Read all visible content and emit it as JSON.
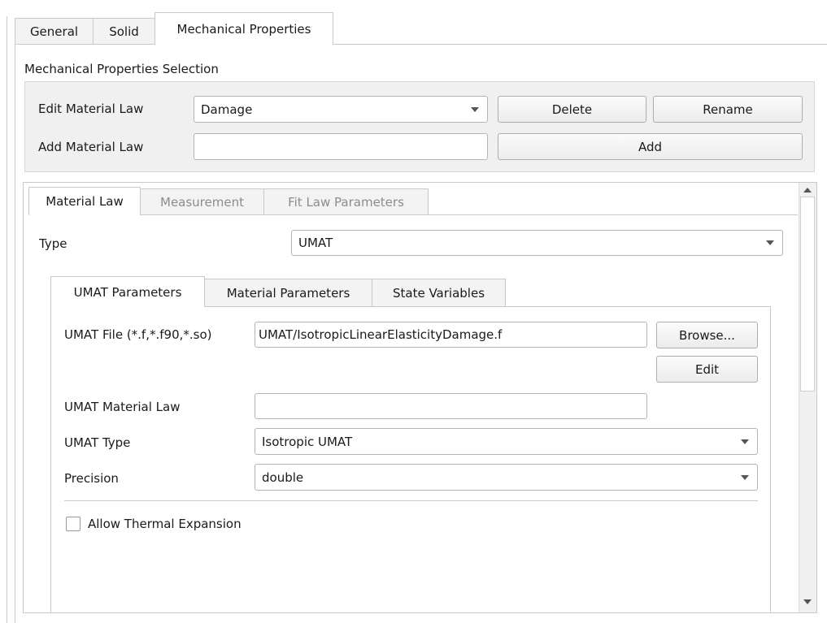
{
  "top_tabs": [
    "General",
    "Solid",
    "Mechanical Properties"
  ],
  "mp_selection": {
    "title": "Mechanical Properties Selection",
    "edit_label": "Edit Material Law",
    "edit_value": "Damage",
    "delete_label": "Delete",
    "rename_label": "Rename",
    "add_label": "Add Material Law",
    "add_value": "",
    "add_button": "Add"
  },
  "law_tabs": [
    "Material Law",
    "Measurement",
    "Fit Law Parameters"
  ],
  "type": {
    "label": "Type",
    "value": "UMAT"
  },
  "umat_tabs": [
    "UMAT Parameters",
    "Material Parameters",
    "State Variables"
  ],
  "umat": {
    "file_label": "UMAT File (*.f,*.f90,*.so)",
    "file_value": "UMAT/IsotropicLinearElasticityDamage.f",
    "browse_label": "Browse...",
    "edit_label": "Edit",
    "law_label": "UMAT Material Law",
    "law_value": "",
    "type_label": "UMAT Type",
    "type_value": "Isotropic UMAT",
    "precision_label": "Precision",
    "precision_value": "double",
    "thermal_label": "Allow Thermal Expansion",
    "thermal_checked": false
  }
}
